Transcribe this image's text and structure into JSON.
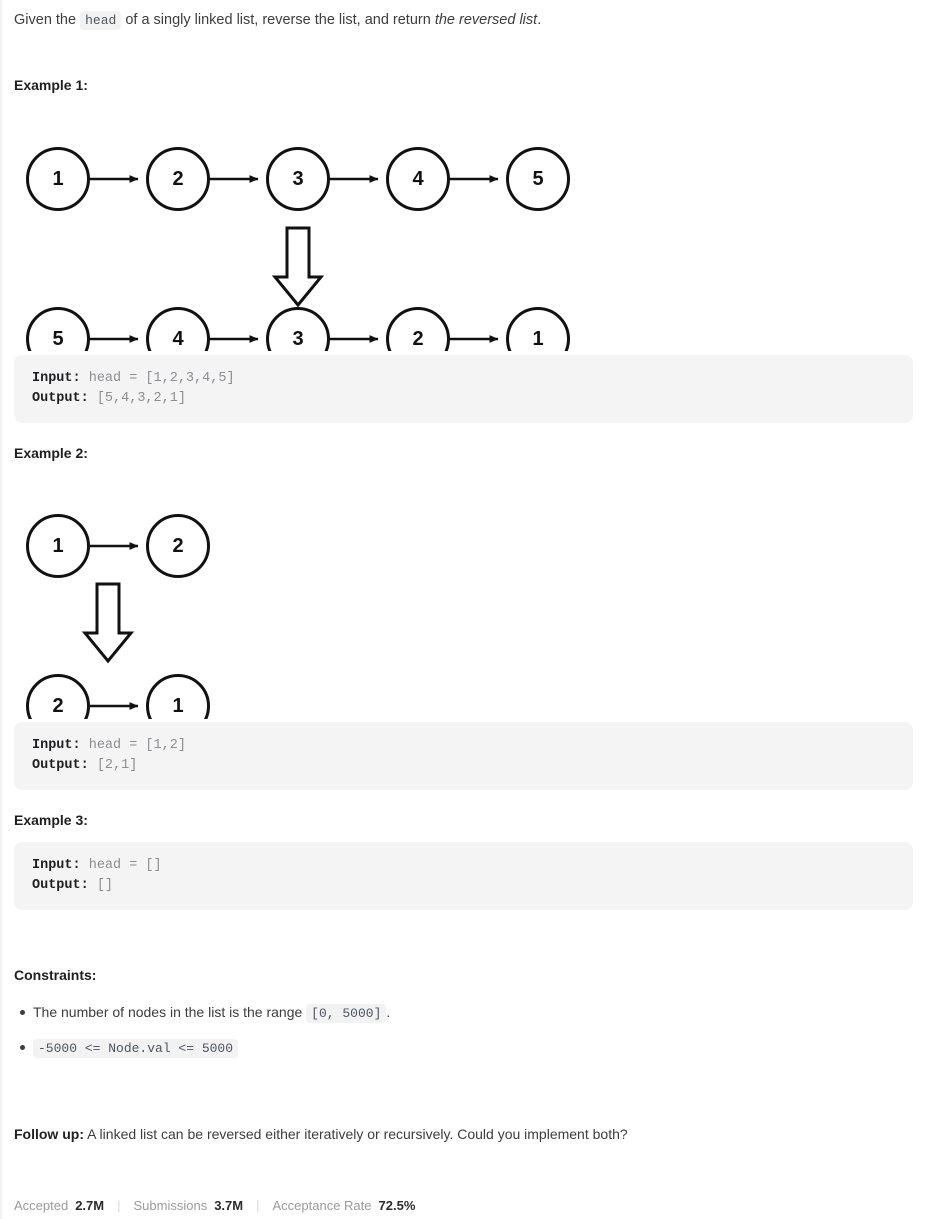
{
  "problem": {
    "statement_prefix": "Given the ",
    "statement_code": "head",
    "statement_mid": " of a singly linked list, reverse the list, and return ",
    "statement_em": "the reversed list",
    "statement_suffix": "."
  },
  "examples": [
    {
      "title": "Example 1:",
      "input_label": "Input:",
      "input_value": "head = [1,2,3,4,5]",
      "output_label": "Output:",
      "output_value": "[5,4,3,2,1]",
      "diagram": {
        "before": [
          1,
          2,
          3,
          4,
          5
        ],
        "after": [
          5,
          4,
          3,
          2,
          1
        ],
        "transform_arrow": "down-block-arrow"
      }
    },
    {
      "title": "Example 2:",
      "input_label": "Input:",
      "input_value": "head = [1,2]",
      "output_label": "Output:",
      "output_value": "[2,1]",
      "diagram": {
        "before": [
          1,
          2
        ],
        "after": [
          2,
          1
        ],
        "transform_arrow": "down-block-arrow"
      }
    },
    {
      "title": "Example 3:",
      "input_label": "Input:",
      "input_value": "head = []",
      "output_label": "Output:",
      "output_value": "[]",
      "diagram": null
    }
  ],
  "constraints": {
    "title": "Constraints:",
    "items": [
      {
        "prefix": "The number of nodes in the list is the range ",
        "code": "[0, 5000]",
        "suffix": "."
      },
      {
        "prefix": "",
        "code": "-5000 <= Node.val <= 5000",
        "suffix": ""
      }
    ]
  },
  "followup": {
    "label": "Follow up:",
    "text": " A linked list can be reversed either iteratively or recursively. Could you implement both?"
  },
  "stats": [
    {
      "label": "Accepted",
      "value": "2.7M"
    },
    {
      "label": "Submissions",
      "value": "3.7M"
    },
    {
      "label": "Acceptance Rate",
      "value": "72.5%"
    }
  ],
  "colors": {
    "code_block_bg": "#f4f4f5",
    "inline_code_bg": "#f2f2f3",
    "text": "#3c3c43",
    "heading": "#1f1f1f",
    "stroke": "#111111"
  }
}
